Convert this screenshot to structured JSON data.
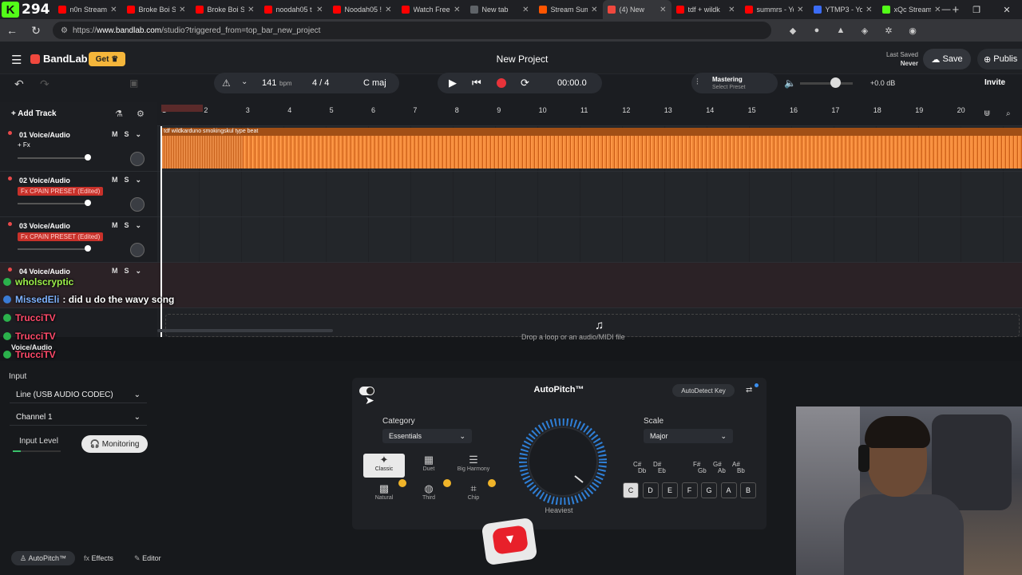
{
  "browser": {
    "counter": "294",
    "tabs": [
      {
        "label": "n0n Stream",
        "color": "#ff0000"
      },
      {
        "label": "Broke Boi Su",
        "color": "#ff0000"
      },
      {
        "label": "Broke Boi Su",
        "color": "#ff0000"
      },
      {
        "label": "noodah05 t",
        "color": "#ff0000"
      },
      {
        "label": "Noodah05 !",
        "color": "#ff0000"
      },
      {
        "label": "Watch Free",
        "color": "#ff0000"
      },
      {
        "label": "New tab",
        "color": "#5f6368"
      },
      {
        "label": "Stream Sum",
        "color": "#ff5500"
      },
      {
        "label": "(4) New",
        "color": "#f0483e"
      },
      {
        "label": "tdf + wildk",
        "color": "#ff0000"
      },
      {
        "label": "summrs - Yo",
        "color": "#ff0000"
      },
      {
        "label": "YTMP3 - Yo",
        "color": "#3b6cf6"
      },
      {
        "label": "xQc Stream",
        "color": "#53fc18"
      }
    ],
    "url_prefix": "https://",
    "url_host": "www.bandlab.com",
    "url_path": "/studio?triggered_from=top_bar_new_project"
  },
  "studio": {
    "brand": "BandLab",
    "get_label": "Get",
    "project_title": "New Project",
    "last_saved_label": "Last Saved",
    "last_saved_value": "Never",
    "save_label": "Save",
    "publish_label": "Publis",
    "invite_label": "Invite",
    "tempo": "141",
    "tempo_unit": "bpm",
    "time_sig": "4 / 4",
    "key": "C maj",
    "time": "00:00.0",
    "mastering_label": "Mastering",
    "mastering_preset": "Select Preset",
    "volume_db": "+0.0 dB",
    "add_track": "Add Track"
  },
  "ruler": [
    "1",
    "2",
    "3",
    "4",
    "5",
    "6",
    "7",
    "8",
    "9",
    "10",
    "11",
    "12",
    "13",
    "14",
    "15",
    "16",
    "17",
    "18",
    "19",
    "20"
  ],
  "tracks": [
    {
      "name": "01 Voice/Audio",
      "fx": "+ Fx",
      "fx_red": false
    },
    {
      "name": "02 Voice/Audio",
      "fx": "Fx CPAIN PRESET (Edited)",
      "fx_red": true
    },
    {
      "name": "03 Voice/Audio",
      "fx": "Fx CPAIN PRESET (Edited)",
      "fx_red": true
    },
    {
      "name": "04 Voice/Audio",
      "fx": "",
      "fx_red": false
    }
  ],
  "clip": {
    "title": "tdf wildkarduno smokingskul type beat"
  },
  "chat": [
    {
      "user": "wholscryptic",
      "msg": "",
      "color": "#9cf04a"
    },
    {
      "user": "MissedEli",
      "msg": ": did u do the wavy song",
      "color": "#7fb3ff"
    },
    {
      "user": "TrucciTV",
      "msg": "",
      "color": "#ff4a6a"
    },
    {
      "user": "TrucciTV",
      "msg": "",
      "color": "#ff4a6a"
    },
    {
      "user": "TrucciTV",
      "msg": "",
      "color": "#ff4a6a"
    }
  ],
  "hint_text": "Drop a loop or an audio/MIDI file",
  "track5_label": "Voice/Audio",
  "input": {
    "label": "Input",
    "device": "Line (USB AUDIO CODEC)",
    "channel": "Channel 1",
    "level_label": "Input Level",
    "monitoring": "Monitoring"
  },
  "autopitch": {
    "title": "AutoPitch™",
    "autodetect": "AutoDetect Key",
    "category_label": "Category",
    "category_value": "Essentials",
    "scale_label": "Scale",
    "scale_value": "Major",
    "dial_label": "Heaviest",
    "effects": [
      {
        "label": "Classic",
        "icon": "✦"
      },
      {
        "label": "Duet",
        "icon": "▦"
      },
      {
        "label": "Big Harmony",
        "icon": "☰"
      },
      {
        "label": "Natural",
        "icon": "▩"
      },
      {
        "label": "Third",
        "icon": "◍"
      },
      {
        "label": "Chip",
        "icon": "⌗"
      }
    ],
    "sharps": [
      {
        "top": "C#",
        "bottom": "Db"
      },
      {
        "top": "D#",
        "bottom": "Eb"
      },
      {
        "top": "F#",
        "bottom": "Gb"
      },
      {
        "top": "G#",
        "bottom": "Ab"
      },
      {
        "top": "A#",
        "bottom": "Bb"
      }
    ],
    "keys": [
      "C",
      "D",
      "E",
      "F",
      "G",
      "A",
      "B"
    ]
  },
  "footer": {
    "autopitch": "AutoPitch™",
    "effects": "Effects",
    "editor": "Editor"
  }
}
